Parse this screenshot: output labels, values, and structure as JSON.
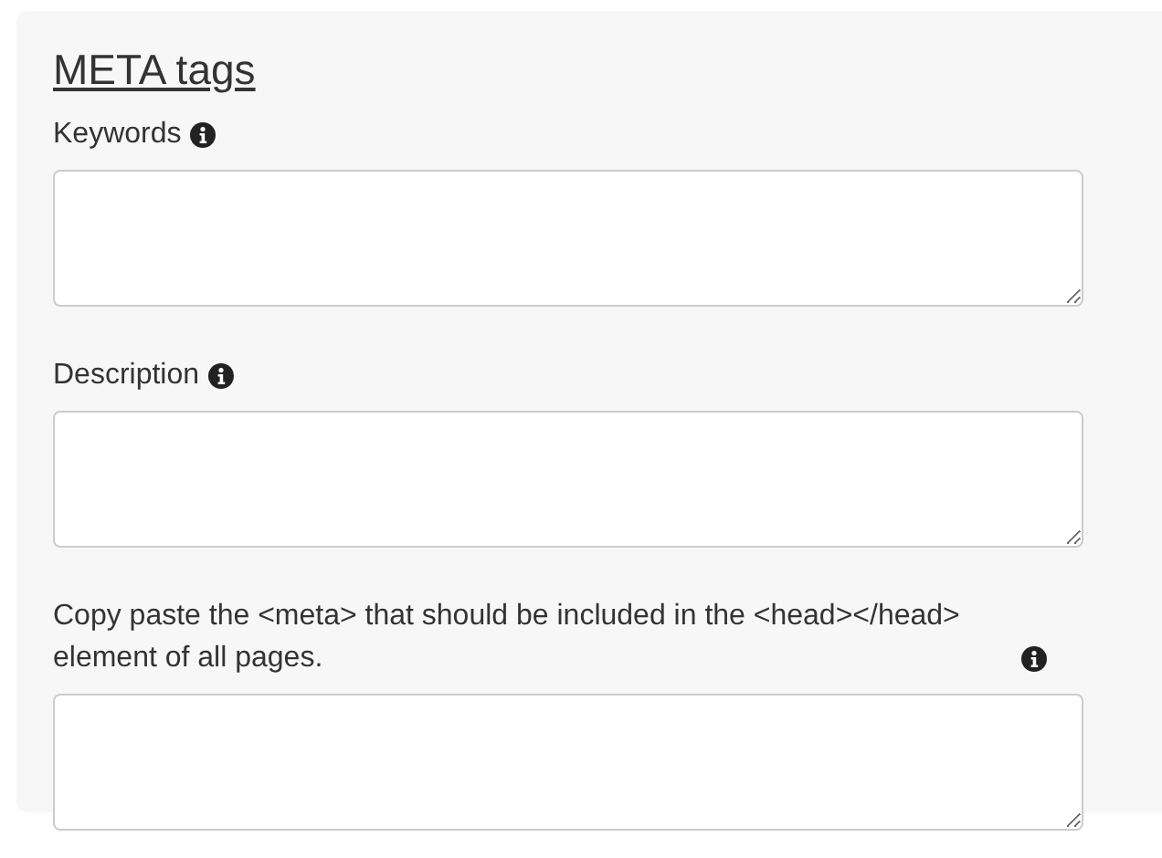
{
  "heading": "META tags",
  "fields": [
    {
      "label": "Keywords"
    },
    {
      "label": "Description"
    },
    {
      "label": "Copy paste the <meta> that should be included in the <head></head> element of all pages."
    }
  ]
}
